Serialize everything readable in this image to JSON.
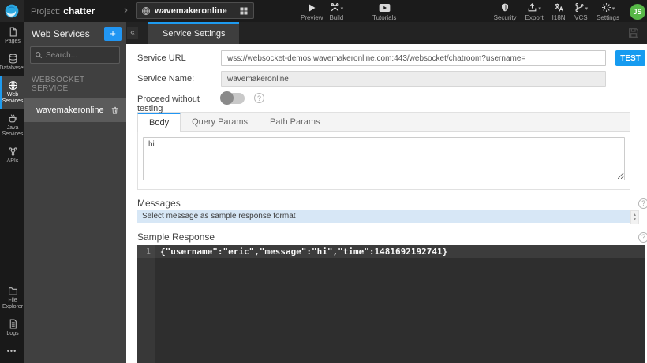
{
  "topbar": {
    "project_label": "Project:",
    "project_name": "chatter",
    "service_tab_label": "wavemakeronline",
    "preview_label": "Preview",
    "build_label": "Build",
    "tutorials_label": "Tutorials",
    "security_label": "Security",
    "export_label": "Export",
    "i18n_label": "I18N",
    "vcs_label": "VCS",
    "settings_label": "Settings",
    "avatar_initials": "JS"
  },
  "icons": {
    "collapse": "«",
    "caret": "▾",
    "chevron": "›",
    "plus": "+",
    "question": "?",
    "scroll_up": "▲",
    "scroll_down": "▼",
    "more_dots": "•••"
  },
  "sidebar": {
    "items": [
      {
        "label": "Pages"
      },
      {
        "label": "Databases"
      },
      {
        "label": "Web Services"
      },
      {
        "label": "Java Services"
      },
      {
        "label": "APIs"
      }
    ],
    "bottom_items": [
      {
        "label": "File Explorer"
      },
      {
        "label": "Logs"
      }
    ]
  },
  "panel": {
    "title": "Web Services",
    "search_placeholder": "Search...",
    "section_title": "WEBSOCKET SERVICE",
    "items": [
      {
        "name": "wavemakeronline"
      }
    ]
  },
  "workspace": {
    "tab_label": "Service Settings",
    "form": {
      "service_url_label": "Service URL",
      "service_url_value": "wss://websocket-demos.wavemakeronline.com:443/websocket/chatroom?username=",
      "test_button": "TEST",
      "service_name_label": "Service Name:",
      "service_name_value": "wavemakeronline",
      "proceed_label": "Proceed without testing"
    },
    "request": {
      "tabs": [
        {
          "label": "Body"
        },
        {
          "label": "Query Params"
        },
        {
          "label": "Path Params"
        }
      ],
      "body_value": "hi"
    },
    "messages": {
      "label": "Messages",
      "selected_text": "Select message as sample response format"
    },
    "sample_response": {
      "label": "Sample Response",
      "line_number": "1",
      "code": "{\"username\":\"eric\",\"message\":\"hi\",\"time\":1481692192741}"
    }
  },
  "colors": {
    "accent_blue": "#1e9bf0",
    "test_button_blue": "#169bf0",
    "avatar_green": "#57b847",
    "selected_message_bg": "#d7e7f6",
    "editor_bg": "#2e2e2e"
  }
}
